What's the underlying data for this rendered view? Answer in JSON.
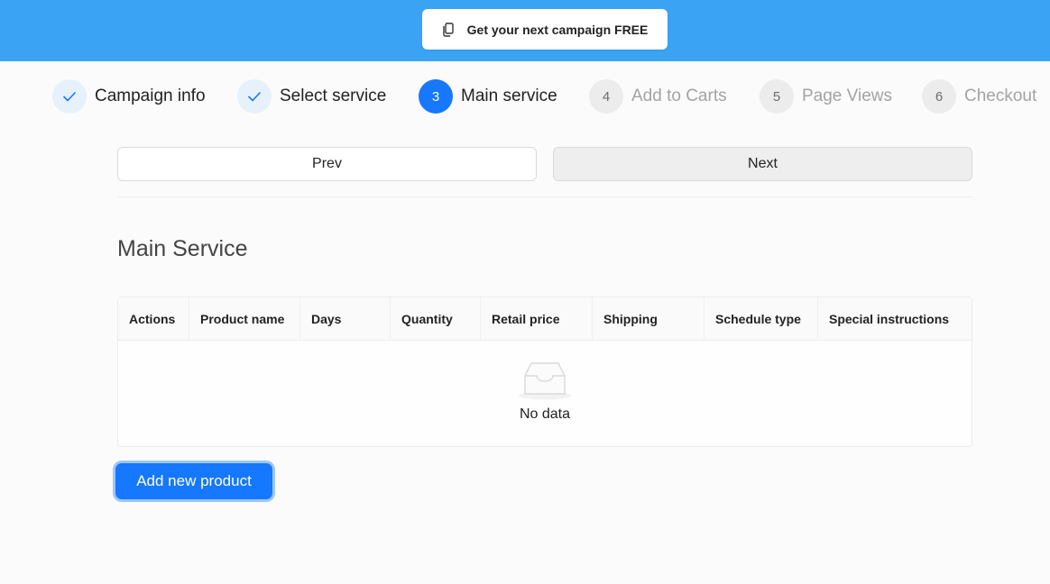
{
  "promo": {
    "icon": "copy-icon",
    "label": "Get your next campaign FREE"
  },
  "steps": [
    {
      "status": "done",
      "marker": "",
      "label": "Campaign info"
    },
    {
      "status": "done",
      "marker": "",
      "label": "Select service"
    },
    {
      "status": "active",
      "marker": "3",
      "label": "Main service"
    },
    {
      "status": "todo",
      "marker": "4",
      "label": "Add to Carts"
    },
    {
      "status": "todo",
      "marker": "5",
      "label": "Page Views"
    },
    {
      "status": "todo",
      "marker": "6",
      "label": "Checkout"
    }
  ],
  "nav": {
    "prev_label": "Prev",
    "next_label": "Next"
  },
  "section": {
    "title": "Main Service"
  },
  "table": {
    "columns": [
      "Actions",
      "Product name",
      "Days",
      "Quantity",
      "Retail price",
      "Shipping",
      "Schedule type",
      "Special instructions"
    ],
    "empty_text": "No data"
  },
  "actions": {
    "add_label": "Add new product"
  },
  "colors": {
    "banner": "#3ba3f4",
    "primary": "#1677ff"
  }
}
